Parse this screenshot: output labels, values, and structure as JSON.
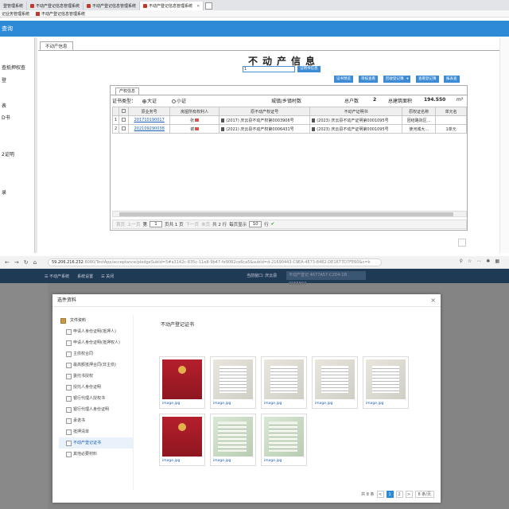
{
  "top": {
    "browser_tabs": [
      "登管理系统",
      "不动产登记信息管理系统",
      "不动产登记信息管理系统",
      "不动产登记信息管理系统"
    ],
    "bookmarks": [
      "记业务管理系统",
      "不动产登记信息管理系统"
    ],
    "app_bar_title": "查询",
    "sidebar": [
      "查抵押权查",
      "登",
      "表",
      "D书",
      "2证明",
      "录"
    ],
    "content_tab": "不动产信息",
    "page_title": "不动产信息",
    "query_value": "1",
    "query_button": "证明书信息",
    "actions": [
      "证书预览",
      "审核查看",
      "回收登记簿",
      "查看登记簿",
      "报表查"
    ],
    "panel_tab": "产权信息",
    "filter": {
      "label": "证书类型：",
      "opt1": "大证",
      "opt2": "小证",
      "scope_label": "城镇/乡镇村数",
      "total_label": "总户数",
      "total_value": "2",
      "area_label": "总建筑面积",
      "area_value": "194.550",
      "area_unit": "m²"
    },
    "table": {
      "headers": [
        "",
        "原业务号",
        "房屋所有权利人",
        "原不动产权证号",
        "不动产证明书",
        "原权证名称",
        "单元名"
      ],
      "rows": [
        {
          "n": "1",
          "id": "201710190017",
          "owner": "张",
          "cert": "(2017) 庆云县不动产权第0003906号",
          "proof": "(2023) 庆云县不动产证明第0001095号",
          "name": "团结路际区...",
          "unit": ""
        },
        {
          "n": "2",
          "id": "202109290038",
          "owner": "谢",
          "cert": "(2021) 庆云县不动产权第0006431号",
          "proof": "(2023) 庆云县不动产证明第0001095号",
          "name": "使河城大...",
          "unit": "1单元"
        }
      ]
    },
    "pager": {
      "first": "首页",
      "prev": "上一页",
      "page_label": "第",
      "page_value": "1",
      "page_total": "页共 1 页",
      "next": "下一页",
      "last": "末页",
      "total": "共 2 行",
      "per_label": "每页显示",
      "per_value": "10",
      "per_unit": "行"
    }
  },
  "bottom": {
    "url_host": "59.206.216.232",
    "url_rest": ":8080/TestApp/acceptance/pledgeSubId=5#a3142c-835c-11e8-9b47-fe9082ce6ca5&subId=d-21690443-C9EA-4E73-8482-DE1677D7FE60&n=k",
    "app_items": [
      "☰ 不动产系统",
      "系统设置",
      "☰ 关闭"
    ],
    "app_right": "当前窗口: 庆云县",
    "app_input": "不动产登记 4677A57-C2D4-1B 0065B60",
    "modal_title": "选件资料",
    "tree": [
      "文件资料",
      "申请人身份证明(抵押人)",
      "申请人身份证明(抵押权人)",
      "主债权合同",
      "最高额抵押合同(非主债)",
      "委托书授权",
      "授托人身份证明",
      "银行代理人授权书",
      "银行代理人身份证明",
      "承诺书",
      "抵押清单",
      "不动产登记证书",
      "其他必要材料"
    ],
    "selected_index": 11,
    "content_title": "不动产登记证书",
    "images": [
      "image.jpg",
      "image.jpg",
      "image.jpg",
      "image.jpg",
      "image.jpg",
      "image.jpg",
      "image.jpg",
      "image.jpg"
    ],
    "pager": {
      "total": "共 8 条",
      "prev": "<",
      "p1": "1",
      "p2": "2",
      "next": ">",
      "per": "8 条/页"
    }
  }
}
